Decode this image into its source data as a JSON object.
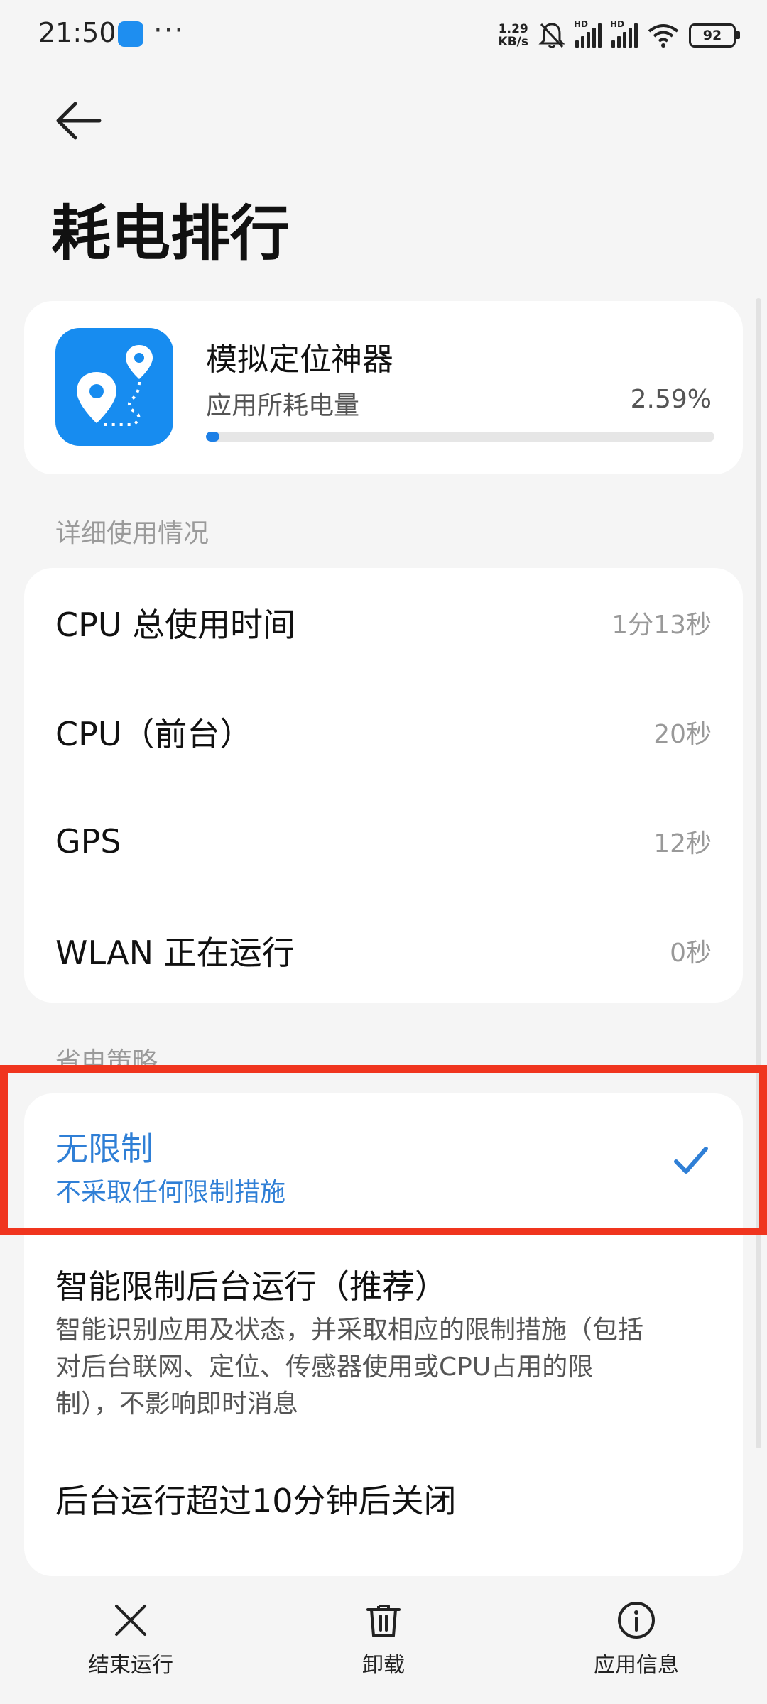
{
  "status_bar": {
    "time": "21:50",
    "dots": "···",
    "net_speed_value": "1.29",
    "net_speed_unit": "KB/s",
    "hd1": "HD",
    "hd2": "HD",
    "battery": "92"
  },
  "header": {
    "title": "耗电排行"
  },
  "app": {
    "name": "模拟定位神器",
    "consumption_label": "应用所耗电量",
    "consumption_value": "2.59%",
    "consumption_fraction": 0.0259
  },
  "usage": {
    "section_title": "详细使用情况",
    "rows": [
      {
        "label": "CPU 总使用时间",
        "value": "1分13秒"
      },
      {
        "label": "CPU（前台）",
        "value": "20秒"
      },
      {
        "label": "GPS",
        "value": "12秒"
      },
      {
        "label": "WLAN 正在运行",
        "value": "0秒"
      }
    ]
  },
  "policy": {
    "section_title": "省电策略",
    "options": [
      {
        "title": "无限制",
        "subtitle": "不采取任何限制措施",
        "selected": true
      },
      {
        "title": "智能限制后台运行（推荐）",
        "subtitle": "智能识别应用及状态，并采取相应的限制措施（包括对后台联网、定位、传感器使用或CPU占用的限制），不影响即时消息",
        "selected": false
      },
      {
        "title": "后台运行超过10分钟后关闭",
        "subtitle": "",
        "selected": false
      }
    ]
  },
  "bottom_bar": {
    "items": [
      {
        "label": "结束运行",
        "icon": "close-icon"
      },
      {
        "label": "卸载",
        "icon": "trash-icon"
      },
      {
        "label": "应用信息",
        "icon": "info-icon"
      }
    ]
  },
  "colors": {
    "accent": "#2f7fd6",
    "app_icon_bg": "#178cf0",
    "highlight_border": "#f0351e"
  }
}
